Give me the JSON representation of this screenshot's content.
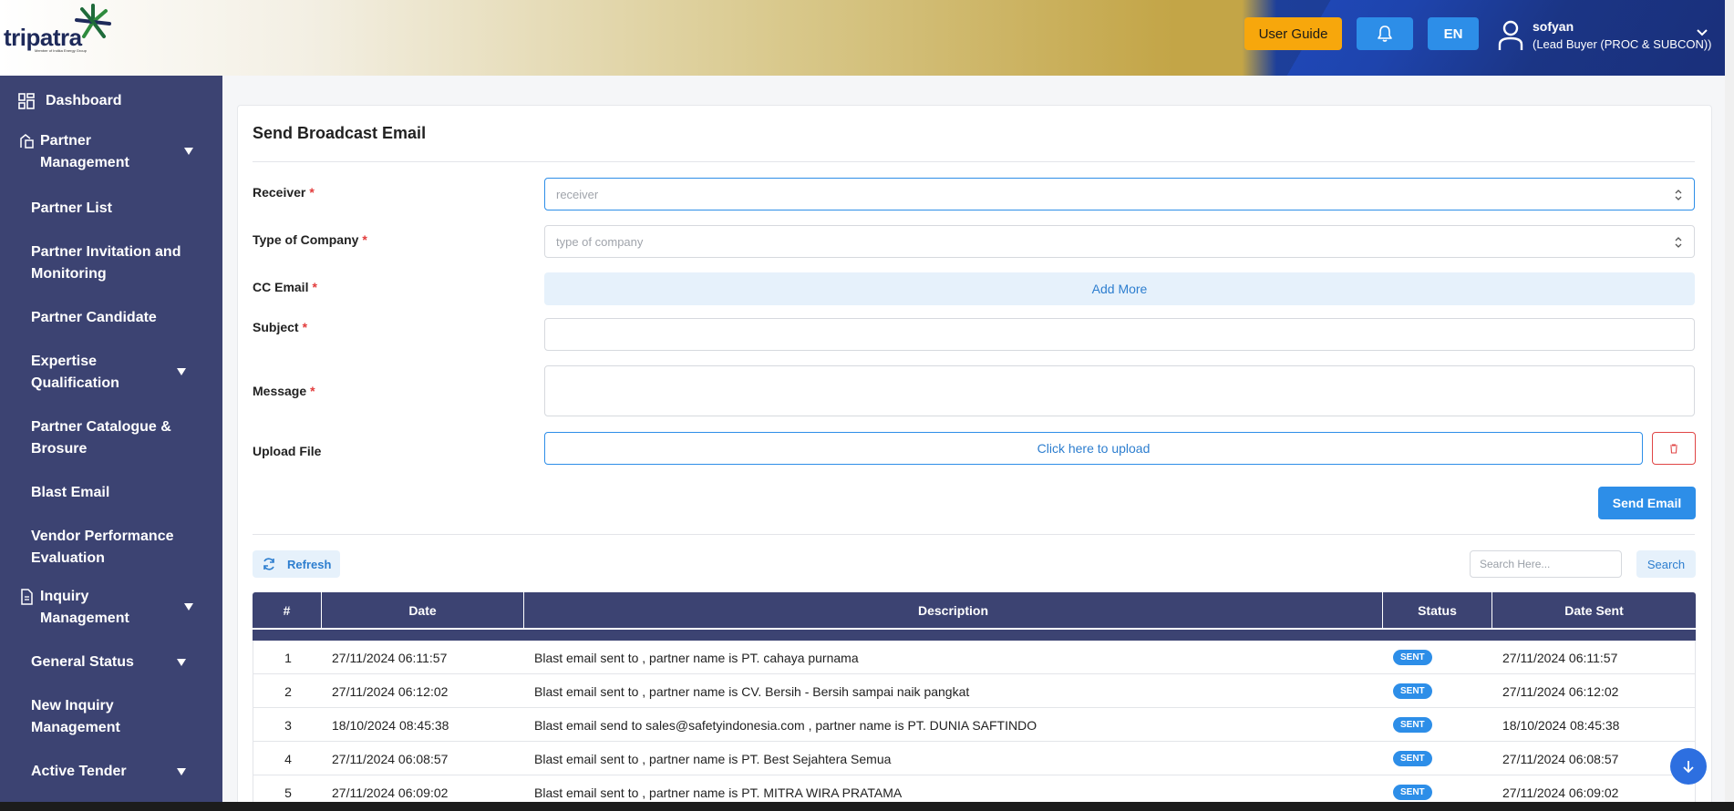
{
  "header": {
    "logo_text": "tripatra",
    "logo_sub": "Member of Indika Energy Group",
    "user_guide_label": "User Guide",
    "language_label": "EN",
    "user_name": "sofyan",
    "user_role": "(Lead Buyer (PROC & SUBCON))",
    "colors": {
      "guide": "#f7a70c",
      "accent": "#2d8ee8",
      "sidebar": "#3c4372"
    }
  },
  "sidebar": {
    "items": [
      {
        "label": "Dashboard",
        "icon": "grid-icon"
      },
      {
        "label": "Partner Management",
        "icon": "partner-icon",
        "expandable": true
      },
      {
        "label": "Partner List"
      },
      {
        "label": "Partner Invitation and Monitoring"
      },
      {
        "label": "Partner Candidate"
      },
      {
        "label": "Expertise Qualification",
        "expandable": true
      },
      {
        "label": "Partner Catalogue & Brosure"
      },
      {
        "label": "Blast Email"
      },
      {
        "label": "Vendor Performance Evaluation"
      },
      {
        "label": "Inquiry Management",
        "icon": "document-icon",
        "expandable": true
      },
      {
        "label": "General Status",
        "expandable": true
      },
      {
        "label": "New Inquiry Management"
      },
      {
        "label": "Active Tender",
        "expandable": true
      }
    ]
  },
  "form": {
    "title": "Send Broadcast Email",
    "receiver_label": "Receiver",
    "receiver_placeholder": "receiver",
    "company_label": "Type of Company",
    "company_placeholder": "type of company",
    "cc_label": "CC Email",
    "add_more_label": "Add More",
    "subject_label": "Subject",
    "message_label": "Message",
    "upload_label": "Upload File",
    "upload_button": "Click here to upload",
    "required_mark": "*",
    "send_label": "Send Email"
  },
  "toolbar": {
    "refresh_label": "Refresh",
    "search_placeholder": "Search Here...",
    "search_label": "Search"
  },
  "table": {
    "columns": [
      "#",
      "Date",
      "Description",
      "Status",
      "Date Sent"
    ],
    "rows": [
      {
        "no": "1",
        "date": "27/11/2024 06:11:57",
        "description": "Blast email sent to , partner name is PT. cahaya purnama",
        "status": "SENT",
        "date_sent": "27/11/2024 06:11:57"
      },
      {
        "no": "2",
        "date": "27/11/2024 06:12:02",
        "description": "Blast email sent to , partner name is CV. Bersih - Bersih sampai naik pangkat",
        "status": "SENT",
        "date_sent": "27/11/2024 06:12:02"
      },
      {
        "no": "3",
        "date": "18/10/2024 08:45:38",
        "description": "Blast email send to sales@safetyindonesia.com , partner name is PT. DUNIA SAFTINDO",
        "status": "SENT",
        "date_sent": "18/10/2024 08:45:38"
      },
      {
        "no": "4",
        "date": "27/11/2024 06:08:57",
        "description": "Blast email sent to , partner name is PT. Best Sejahtera Semua",
        "status": "SENT",
        "date_sent": "27/11/2024 06:08:57"
      },
      {
        "no": "5",
        "date": "27/11/2024 06:09:02",
        "description": "Blast email sent to , partner name is PT. MITRA WIRA PRATAMA",
        "status": "SENT",
        "date_sent": "27/11/2024 06:09:02"
      }
    ]
  }
}
